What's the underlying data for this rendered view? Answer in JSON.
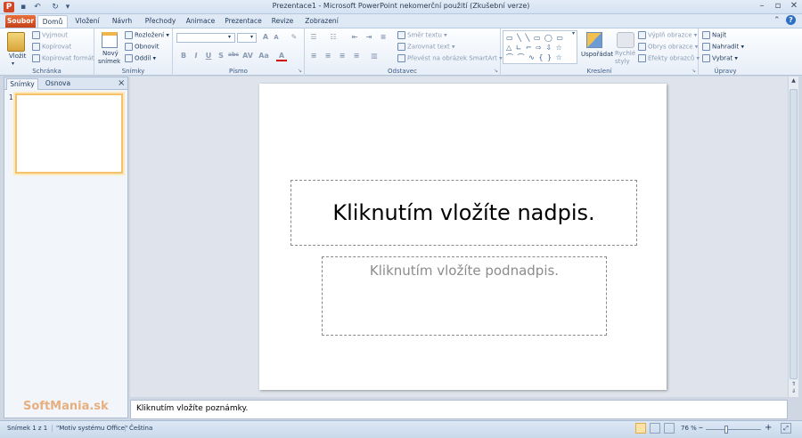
{
  "window": {
    "title": "Prezentace1  -  Microsoft PowerPoint nekomerční použití (Zkušební verze)"
  },
  "tabs": [
    "Soubor",
    "Domů",
    "Vložení",
    "Návrh",
    "Přechody",
    "Animace",
    "Prezentace",
    "Revize",
    "Zobrazení"
  ],
  "ribbon": {
    "clipboard": {
      "paste": "Vložit",
      "cut": "Vyjmout",
      "copy": "Kopírovat",
      "format_painter": "Kopírovat formát",
      "label": "Schránka"
    },
    "slides": {
      "new_slide_1": "Nový",
      "new_slide_2": "snímek",
      "layout": "Rozložení",
      "reset": "Obnovit",
      "section": "Oddíl",
      "label": "Snímky"
    },
    "font": {
      "label": "Písmo",
      "bold": "B",
      "italic": "I",
      "underline": "U",
      "strike": "S",
      "shadow": "abc"
    },
    "paragraph": {
      "text_direction": "Směr textu",
      "align_text": "Zarovnat text",
      "smartart": "Převést na obrázek SmartArt",
      "label": "Odstavec"
    },
    "drawing": {
      "arrange": "Uspořádat",
      "quick_styles_1": "Rychlé",
      "quick_styles_2": "styly",
      "fill": "Výplň obrazce",
      "outline": "Obrys obrazce",
      "effects": "Efekty obrazců",
      "label": "Kreslení"
    },
    "editing": {
      "find": "Najít",
      "replace": "Nahradit",
      "select": "Vybrat",
      "label": "Úpravy"
    }
  },
  "panel": {
    "tab_slides": "Snímky",
    "tab_outline": "Osnova",
    "slide_number": "1",
    "close": "×"
  },
  "slide": {
    "title_placeholder": "Kliknutím vložíte nadpis.",
    "subtitle_placeholder": "Kliknutím vložíte podnadpis."
  },
  "notes": {
    "placeholder": "Kliknutím vložíte poznámky."
  },
  "status": {
    "slide_info": "Snímek 1 z 1",
    "theme": "\"Motiv systému Office\"",
    "language": "Čeština",
    "zoom": "76 %",
    "zoom_value": 0.76
  },
  "watermark": "SoftMania.sk",
  "colors": {
    "file_tab": "#d3531f",
    "accent": "#1e395b",
    "selection": "#f5c26b"
  }
}
